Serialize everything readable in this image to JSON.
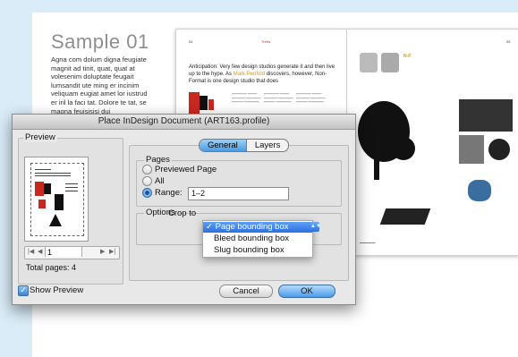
{
  "background_page": {
    "title": "Sample 01",
    "body_text": "Agna com dolum digna feugiate magnit ad tinit, quat, quat at volesenim doluptate feugait lumsandit ute ming er incinim veliquam eugiat amet lor iustrud er iril la faci tat. Dolore te tat, se magna feuisisisi dui"
  },
  "spread": {
    "left_page_number": "54",
    "right_page_number": "55",
    "header_label": "Trefla",
    "intro_text_before": "Anticipation: Very few design studios generate it and then live up to the hype. As",
    "intro_highlight": "Mark Penfold",
    "intro_text_after": "discovers, however, Non-Format is one design studio that does",
    "right_header_label": "N-F"
  },
  "dialog": {
    "title": "Place InDesign Document (ART163.profile)",
    "preview_label": "Preview",
    "page_field_value": "1",
    "total_pages": "Total pages: 4",
    "tabs": [
      "General",
      "Layers"
    ],
    "pages_label": "Pages",
    "radio_previewed": "Previewed Page",
    "radio_all": "All",
    "radio_range": "Range:",
    "range_value": "1–2",
    "options_label": "Options",
    "crop_to_label": "Crop to",
    "crop_options": [
      "Page bounding box",
      "Bleed bounding box",
      "Slug bounding box"
    ],
    "selected_option_mark": "✓",
    "show_preview_label": "Show Preview",
    "cancel_label": "Cancel",
    "ok_label": "OK"
  },
  "colors": {
    "accent_blue": "#4a9be3",
    "background": "#d9ecf7",
    "highlight": "#d19a1f"
  }
}
